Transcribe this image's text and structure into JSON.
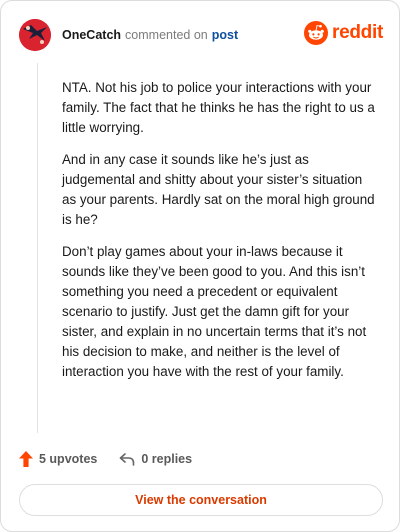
{
  "header": {
    "author": "OneCatch",
    "commented_text": "commented on",
    "post_link": "post",
    "brand": "reddit",
    "avatar_icon": "user-avatar-icon",
    "brand_icon": "reddit-snoo-icon"
  },
  "comment": {
    "paragraphs": [
      "NTA. Not his job to police your interactions with your family. The fact that he thinks he has the right to us a little worrying.",
      "And in any case it sounds like he’s just as judgemental and shitty about your sister’s situation as your parents. Hardly sat on the moral high ground is he?",
      "Don’t play games about your in-laws because it sounds like they’ve been good to you. And this isn’t something you need a precedent or equivalent scenario to justify. Just get the damn gift for your sister, and explain in no uncertain terms that it’s not his decision to make, and neither is the level of interaction you have with the rest of your family."
    ]
  },
  "actions": {
    "upvotes": "5 upvotes",
    "replies": "0 replies",
    "upvote_icon": "upvote-arrow-icon",
    "reply_icon": "reply-arrow-icon"
  },
  "cta": {
    "label": "View the conversation"
  },
  "colors": {
    "brand": "#ff4500",
    "upvote": "#ff4500",
    "link": "#0e4fa0",
    "cta_text": "#d93a00"
  }
}
